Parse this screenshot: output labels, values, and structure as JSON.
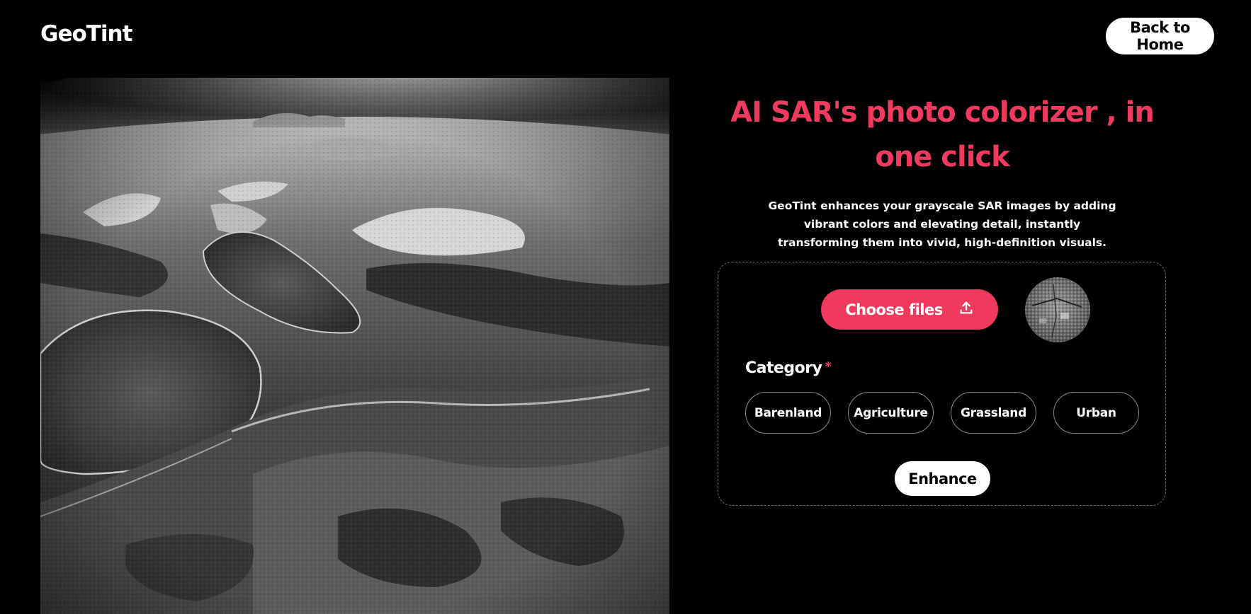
{
  "header": {
    "logo_text": "GeoTint",
    "back_button_label": "Back to Home"
  },
  "hero": {
    "headline": "AI SAR's photo colorizer , in one click",
    "description": "GeoTint enhances your grayscale SAR images by adding vibrant colors and elevating detail, instantly transforming them into vivid, high-definition visuals."
  },
  "upload": {
    "choose_files_label": "Choose files",
    "upload_icon": "upload-icon"
  },
  "category": {
    "label": "Category",
    "required_marker": "*",
    "options": [
      "Barenland",
      "Agriculture",
      "Grassland",
      "Urban"
    ]
  },
  "actions": {
    "enhance_label": "Enhance"
  },
  "colors": {
    "accent": "#f03a5f",
    "background": "#000000",
    "text": "#ffffff"
  }
}
